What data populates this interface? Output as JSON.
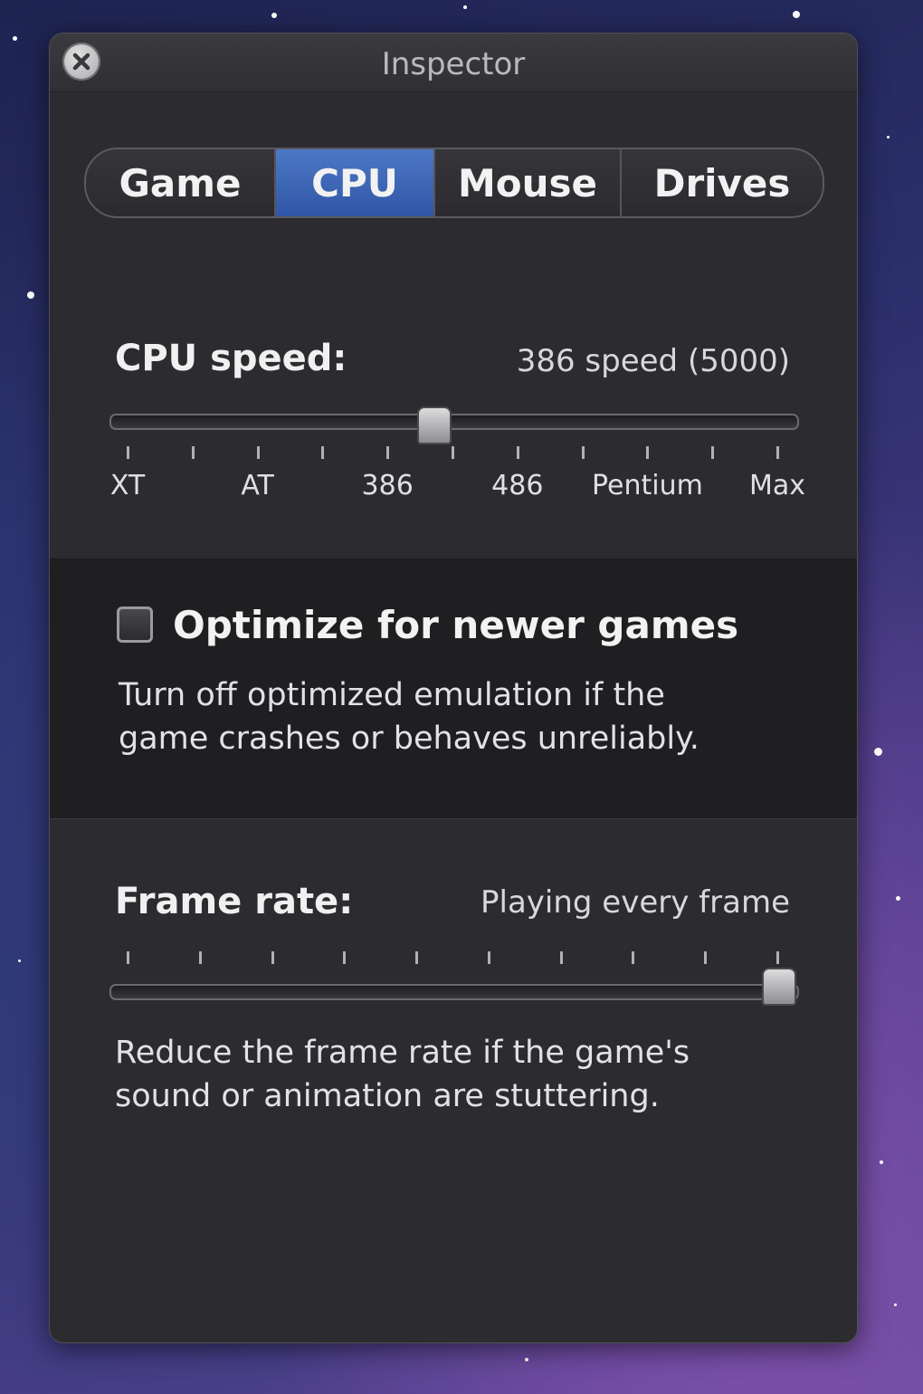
{
  "window": {
    "title": "Inspector",
    "close_icon": "close-icon"
  },
  "tabs": [
    {
      "label": "Game",
      "active": false
    },
    {
      "label": "CPU",
      "active": true
    },
    {
      "label": "Mouse",
      "active": false
    },
    {
      "label": "Drives",
      "active": false
    }
  ],
  "cpu": {
    "label": "CPU speed:",
    "value_text": "386 speed (5000)",
    "tick_labels": [
      "XT",
      "AT",
      "386",
      "486",
      "Pentium",
      "Max"
    ],
    "slider_fraction": 0.47
  },
  "optimize": {
    "label": "Optimize for newer games",
    "checked": false,
    "description_line1": "Turn off optimized emulation if the",
    "description_line2": "game crashes or behaves unreliably."
  },
  "frame_rate": {
    "label": "Frame rate:",
    "value_text": "Playing every frame",
    "slider_fraction": 1.0,
    "description_line1": "Reduce the frame rate if the game's",
    "description_line2": "sound or animation are stuttering."
  },
  "colors": {
    "accent_tab": "#3d66b6",
    "panel_bg": "#2c2c30"
  }
}
